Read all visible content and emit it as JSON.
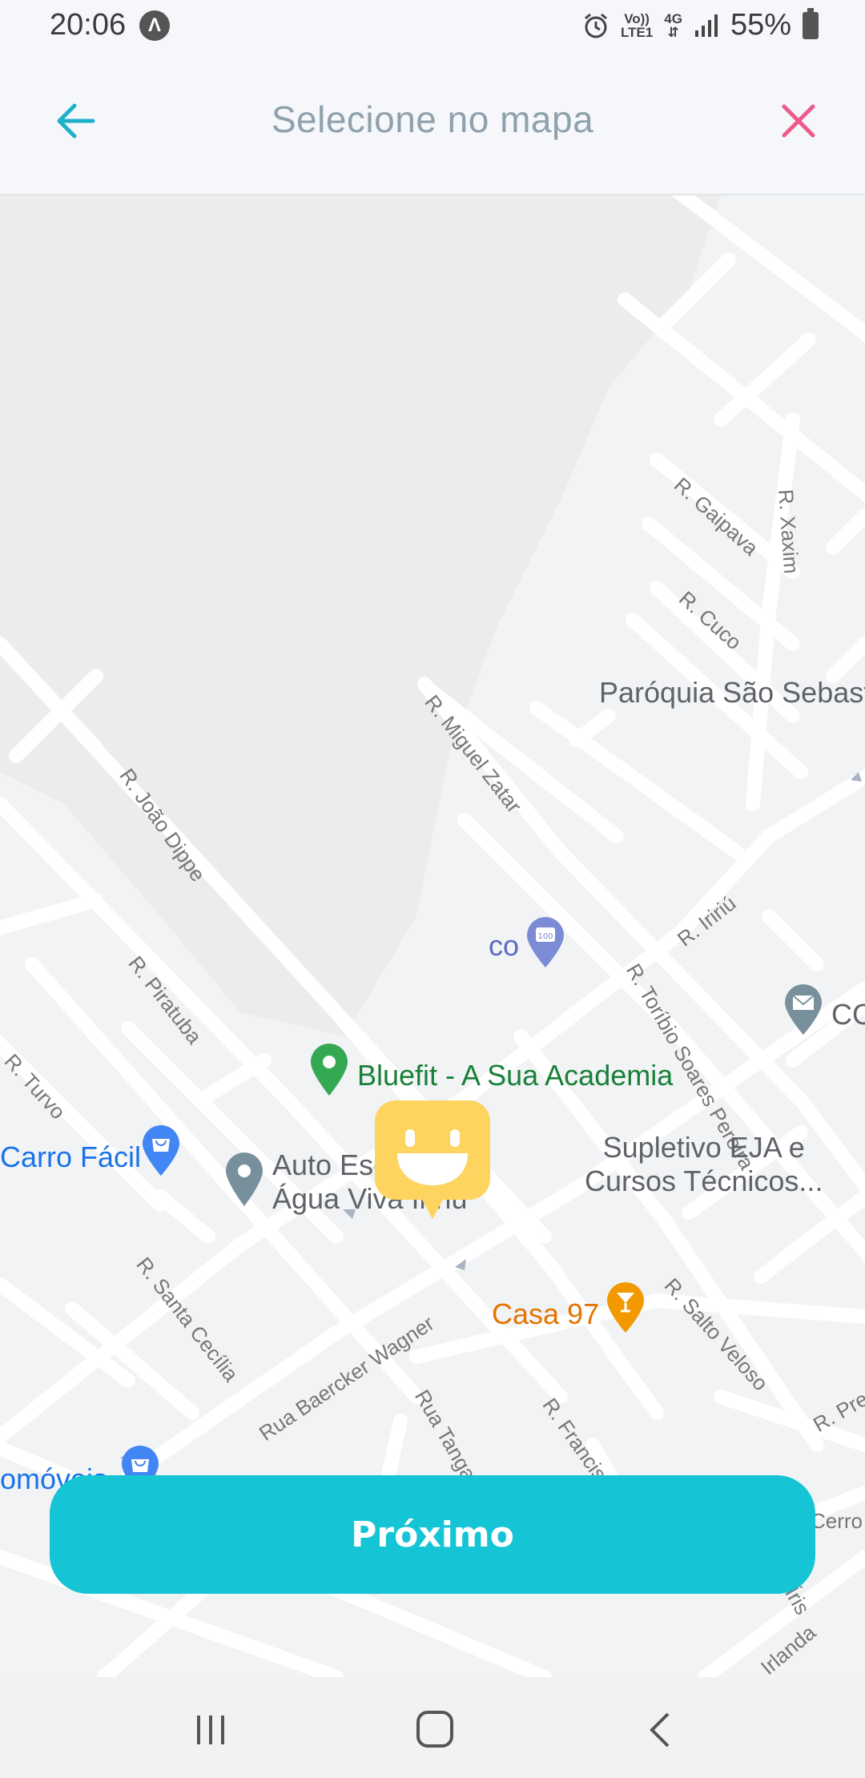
{
  "status_bar": {
    "time": "20:06",
    "network_top": "Vo))",
    "network_bottom": "LTE1",
    "data_type": "4G",
    "battery": "55%"
  },
  "header": {
    "title": "Selecione no mapa",
    "accent_color": "#1fb1c9",
    "close_color": "#ee5a8a"
  },
  "map": {
    "streets": [
      "R. Gaipava",
      "R. Xaxim",
      "R. Cuco",
      "R. Miguel Zatar",
      "R. João Dippe",
      "R. Iririú",
      "R. Piratuba",
      "R. Toríbio Soares Pereira",
      "R. Turvo",
      "R. Santa Cecília",
      "Rua Baercker Wagner",
      "Rua Tangará",
      "R. Francisco",
      "R. Salto Veloso",
      "R. Pres",
      "Cerro V",
      "Íris",
      "Irlanda"
    ],
    "pois": {
      "paroquia": "Paróquia São Sebast",
      "bank_partial": "co",
      "bluefit": "Bluefit - A Sua Academia",
      "post_office_partial": "CC",
      "carro_facil": "Carro Fácil",
      "auto_escola_line1": "Auto Escola",
      "auto_escola_line2": "Água Viva Iririú",
      "supletivo_line1": "Supletivo EJA e",
      "supletivo_line2": "Cursos Técnicos...",
      "casa97": "Casa 97",
      "automoveis_partial": "omóveis"
    }
  },
  "next_button": {
    "label": "Próximo",
    "color": "#15c5d6"
  }
}
